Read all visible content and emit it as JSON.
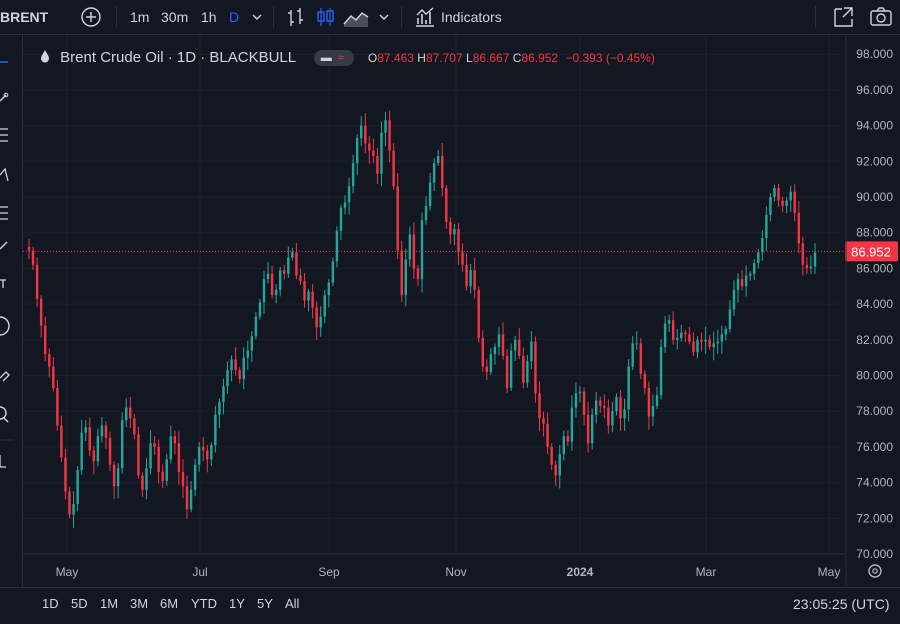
{
  "toolbar": {
    "symbol": "BRENT",
    "intervals": [
      "1m",
      "30m",
      "1h",
      "D"
    ],
    "active_interval": "D",
    "indicators_label": "Indicators"
  },
  "legend": {
    "title": "Brent Crude Oil · 1D · BLACKBULL",
    "open_label": "O",
    "open": "87.463",
    "high_label": "H",
    "high": "87.707",
    "low_label": "L",
    "low": "86.667",
    "close_label": "C",
    "close": "86.952",
    "change": "−0.393 (−0.45%)"
  },
  "price_scale": {
    "ticks": [
      "98.000",
      "96.000",
      "94.000",
      "92.000",
      "90.000",
      "88.000",
      "86.000",
      "84.000",
      "82.000",
      "80.000",
      "78.000",
      "76.000",
      "74.000",
      "72.000",
      "70.000"
    ],
    "last_price": "86.952"
  },
  "time_scale": {
    "labels": [
      "May",
      "Jul",
      "Sep",
      "Nov",
      "2024",
      "Mar",
      "May"
    ]
  },
  "bottombar": {
    "ranges": [
      "1D",
      "5D",
      "1M",
      "3M",
      "6M",
      "YTD",
      "1Y",
      "5Y",
      "All"
    ],
    "clock": "23:05:25 (UTC)"
  },
  "chart_data": {
    "type": "candlestick",
    "title": "Brent Crude Oil · 1D · BLACKBULL",
    "x_axis": [
      "May",
      "Jul",
      "Sep",
      "Nov",
      "2024",
      "Mar",
      "May"
    ],
    "ylim": [
      69.2,
      98.2
    ],
    "grid": true,
    "up_color": "#26a69a",
    "down_color": "#f23645",
    "last_price": 86.952,
    "series": [
      {
        "name": "Close",
        "values": [
          87.0,
          86.2,
          84.3,
          82.8,
          81.2,
          80.5,
          79.3,
          77.2,
          75.4,
          73.5,
          72.2,
          72.8,
          74.7,
          76.8,
          77.1,
          75.8,
          75.2,
          76.6,
          77.2,
          76.5,
          75.0,
          73.8,
          74.8,
          77.5,
          78.2,
          77.6,
          76.7,
          74.4,
          73.6,
          74.8,
          76.2,
          76.0,
          74.6,
          74.1,
          75.3,
          76.6,
          76.2,
          74.6,
          73.8,
          72.5,
          73.6,
          75.0,
          76.0,
          75.8,
          75.3,
          76.1,
          77.8,
          78.5,
          79.4,
          80.3,
          80.9,
          80.3,
          79.8,
          81.0,
          81.4,
          82.2,
          83.3,
          84.1,
          85.4,
          85.7,
          84.5,
          84.8,
          85.9,
          85.7,
          86.6,
          86.9,
          85.6,
          85.3,
          84.2,
          84.7,
          83.8,
          82.7,
          83.3,
          84.5,
          85.2,
          86.4,
          88.1,
          89.4,
          89.7,
          90.6,
          91.9,
          93.3,
          94.0,
          93.0,
          92.6,
          92.3,
          91.3,
          93.6,
          94.3,
          92.6,
          90.6,
          87.0,
          84.5,
          86.5,
          87.9,
          86.0,
          85.4,
          88.7,
          89.5,
          90.8,
          91.9,
          92.3,
          90.5,
          88.6,
          87.9,
          88.2,
          86.9,
          86.2,
          85.0,
          85.9,
          84.8,
          82.1,
          80.5,
          80.2,
          81.2,
          81.6,
          82.3,
          81.1,
          79.3,
          81.4,
          82.0,
          81.1,
          79.6,
          80.8,
          81.9,
          79.0,
          77.6,
          77.3,
          76.0,
          75.0,
          74.4,
          75.6,
          76.6,
          76.3,
          78.2,
          79.0,
          79.1,
          77.8,
          76.2,
          77.8,
          78.6,
          78.3,
          78.2,
          77.2,
          78.0,
          78.8,
          77.6,
          78.1,
          80.5,
          81.8,
          81.8,
          80.1,
          79.3,
          77.7,
          78.3,
          78.9,
          81.6,
          82.9,
          83.1,
          82.0,
          82.1,
          82.4,
          82.3,
          81.9,
          81.3,
          82.0,
          81.9,
          82.0,
          81.6,
          81.8,
          81.9,
          82.3,
          82.6,
          83.7,
          84.8,
          85.4,
          85.0,
          85.6,
          85.7,
          86.3,
          86.9,
          87.7,
          89.0,
          90.0,
          90.5,
          89.8,
          89.5,
          89.8,
          90.3,
          89.1,
          87.4,
          86.2,
          86.0,
          86.1,
          86.9
        ]
      }
    ]
  }
}
